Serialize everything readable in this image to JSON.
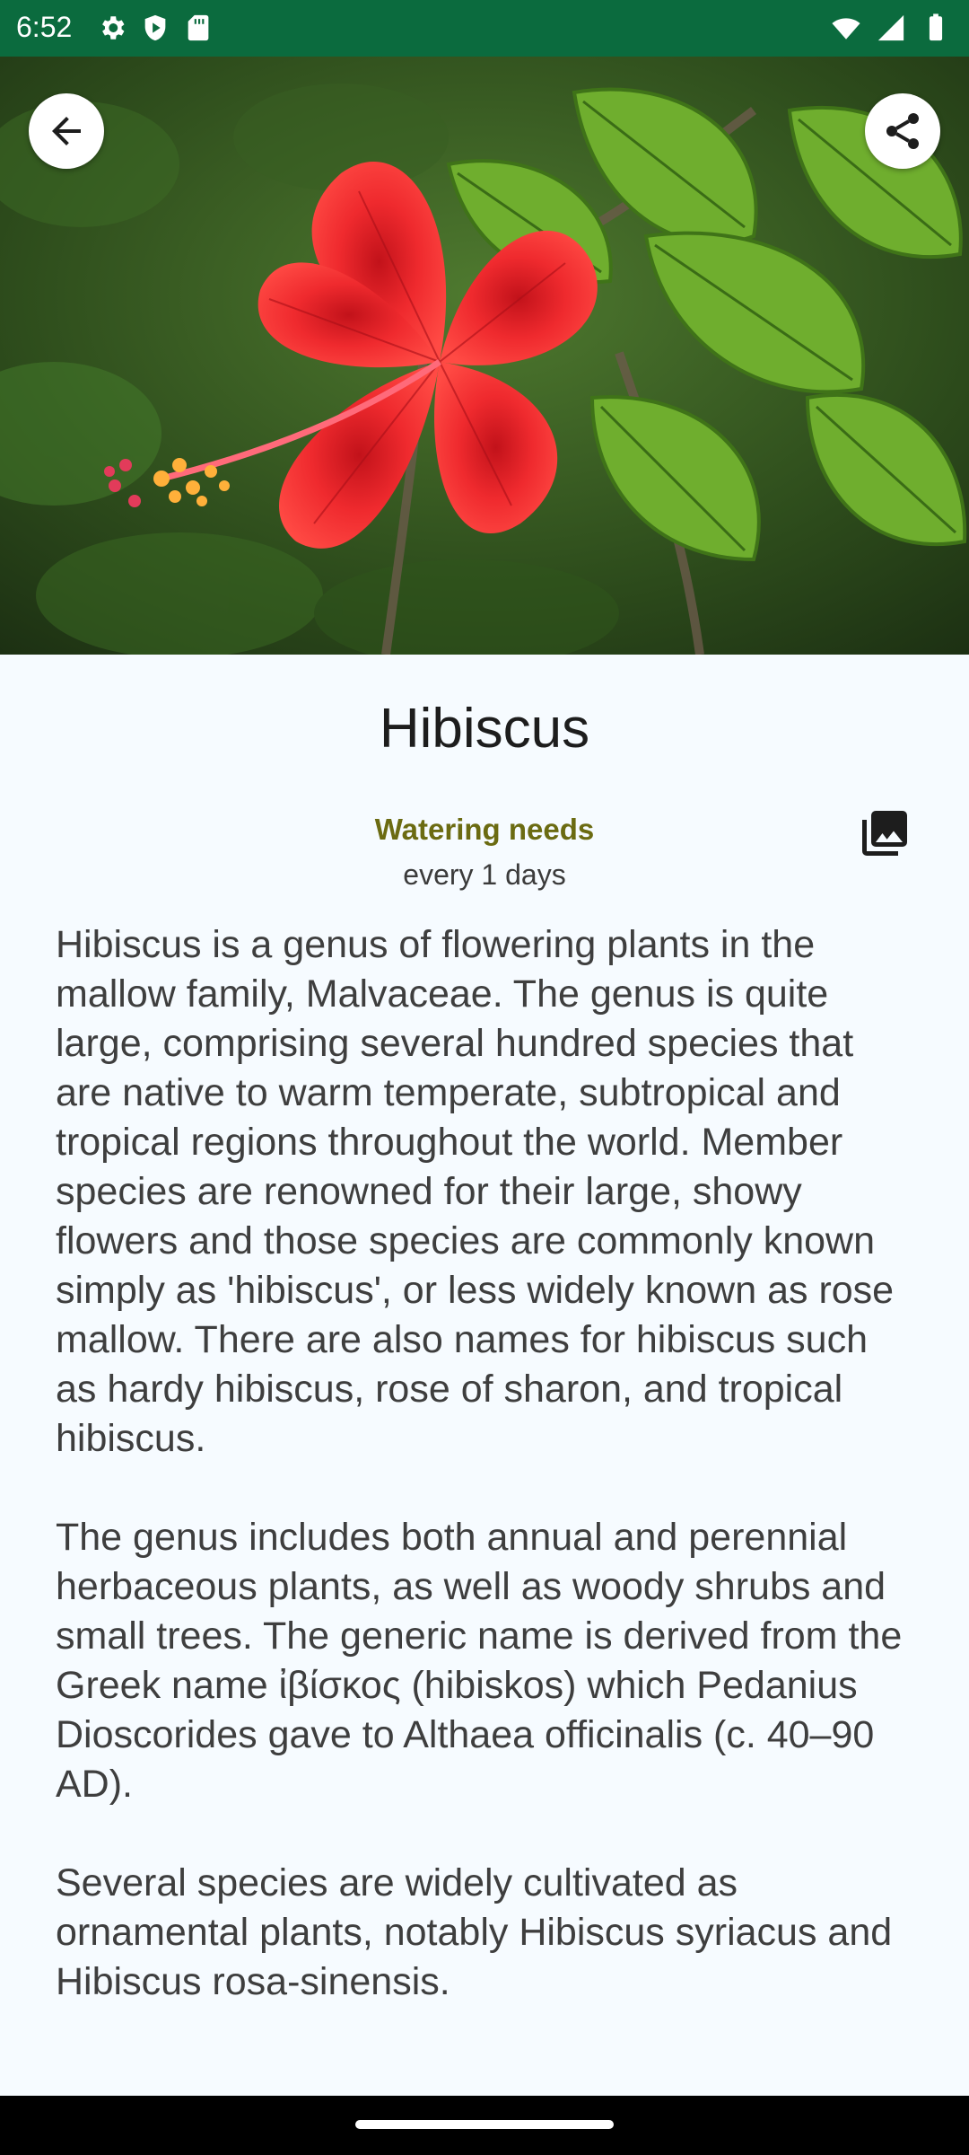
{
  "status_bar": {
    "time": "6:52",
    "left_icons": [
      "settings-icon",
      "shield-icon",
      "sd-card-icon"
    ],
    "right_icons": [
      "wifi-icon",
      "signal-icon",
      "battery-icon"
    ],
    "background": "#0b6b3e"
  },
  "hero": {
    "image_subject": "red hibiscus flower with green leaves",
    "back_icon": "arrow-back-icon",
    "share_icon": "share-icon"
  },
  "plant": {
    "name": "Hibiscus",
    "watering_label": "Watering needs",
    "watering_value": "every 1 days",
    "gallery_icon": "photo-library-icon",
    "description": [
      "Hibiscus is a genus of flowering plants in the mallow family, Malvaceae. The genus is quite large, comprising several hundred species that are native to warm temperate, subtropical and tropical regions throughout the world. Member species are renowned for their large, showy flowers and those species are commonly known simply as 'hibiscus', or less widely known as rose mallow. There are also names for hibiscus such as hardy hibiscus, rose of sharon, and tropical hibiscus.",
      "The genus includes both annual and perennial herbaceous plants, as well as woody shrubs and small trees. The generic name is derived from the Greek name ἰβίσκος (hibiskos) which Pedanius Dioscorides gave to Althaea officinalis (c. 40–90 AD).",
      "Several species are widely cultivated as ornamental plants, notably Hibiscus syriacus and Hibiscus rosa-sinensis."
    ]
  },
  "colors": {
    "accent_label": "#6b6b12",
    "page_background": "#f6fbff"
  }
}
